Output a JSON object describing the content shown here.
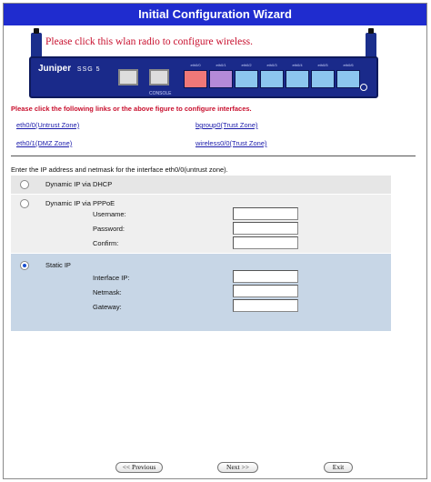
{
  "window": {
    "title": "Initial Configuration Wizard"
  },
  "banner": {
    "wlan_prompt": "Please click this wlan radio to configure wireless.",
    "device": {
      "brand": "Juniper",
      "brand_sub": "NETWORKS",
      "model": "SSG 5",
      "console_label": "CONSOLE"
    },
    "port_labels": [
      "eth0/0",
      "eth0/1",
      "eth0/2",
      "eth0/3",
      "eth0/4",
      "eth0/5",
      "eth0/6"
    ],
    "colors": {
      "untrust": "#f07878",
      "dmz": "#b48ad8",
      "trust": "#8cc6ee"
    }
  },
  "interfaces": {
    "instruction": "Please click the following links or the above figure to configure interfaces.",
    "links": [
      "eth0/0(Untrust Zone)",
      "bgroup0(Trust Zone)",
      "eth0/1(DMZ Zone)",
      "wireless0/0(Trust Zone)"
    ]
  },
  "form": {
    "prompt": "Enter the IP address and netmask for the interface eth0/0(untrust zone).",
    "options": [
      {
        "label": "Dynamic IP via DHCP",
        "selected": false
      },
      {
        "label": "Dynamic IP via PPPoE",
        "selected": false,
        "fields": [
          "Username:",
          "Password:",
          "Confirm:"
        ]
      },
      {
        "label": "Static IP",
        "selected": true,
        "fields": [
          "Interface IP:",
          "Netmask:",
          "Gateway:"
        ]
      }
    ]
  },
  "buttons": {
    "previous": "<< Previous",
    "next": "Next >>",
    "exit": "Exit"
  }
}
